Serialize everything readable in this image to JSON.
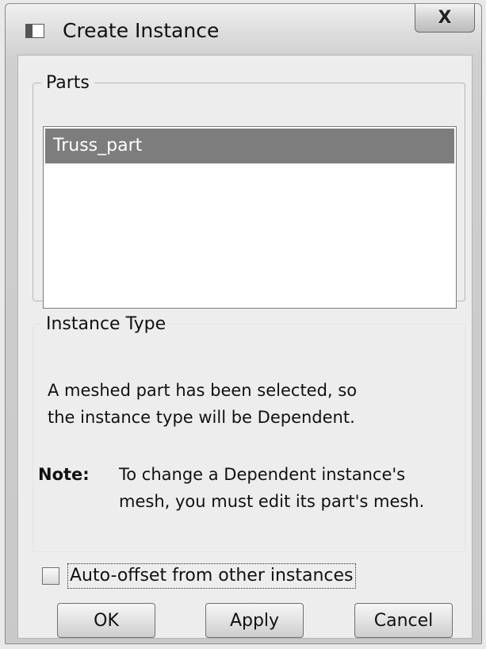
{
  "window": {
    "title": "Create Instance",
    "close_label": "X"
  },
  "parts": {
    "group_label": "Parts",
    "items": [
      "Truss_part"
    ],
    "selected": "Truss_part"
  },
  "instance_type": {
    "group_label": "Instance Type",
    "message_line1": "A meshed part has been selected, so",
    "message_line2": "the instance type will be Dependent.",
    "note_label": "Note:",
    "note_line1": "To change a Dependent instance's",
    "note_line2": "mesh, you must edit its part's mesh."
  },
  "auto_offset": {
    "label": "Auto-offset from other instances",
    "checked": false
  },
  "buttons": {
    "ok": "OK",
    "apply": "Apply",
    "cancel": "Cancel"
  },
  "icons": {
    "title": "window-app-icon",
    "close": "close-icon"
  }
}
